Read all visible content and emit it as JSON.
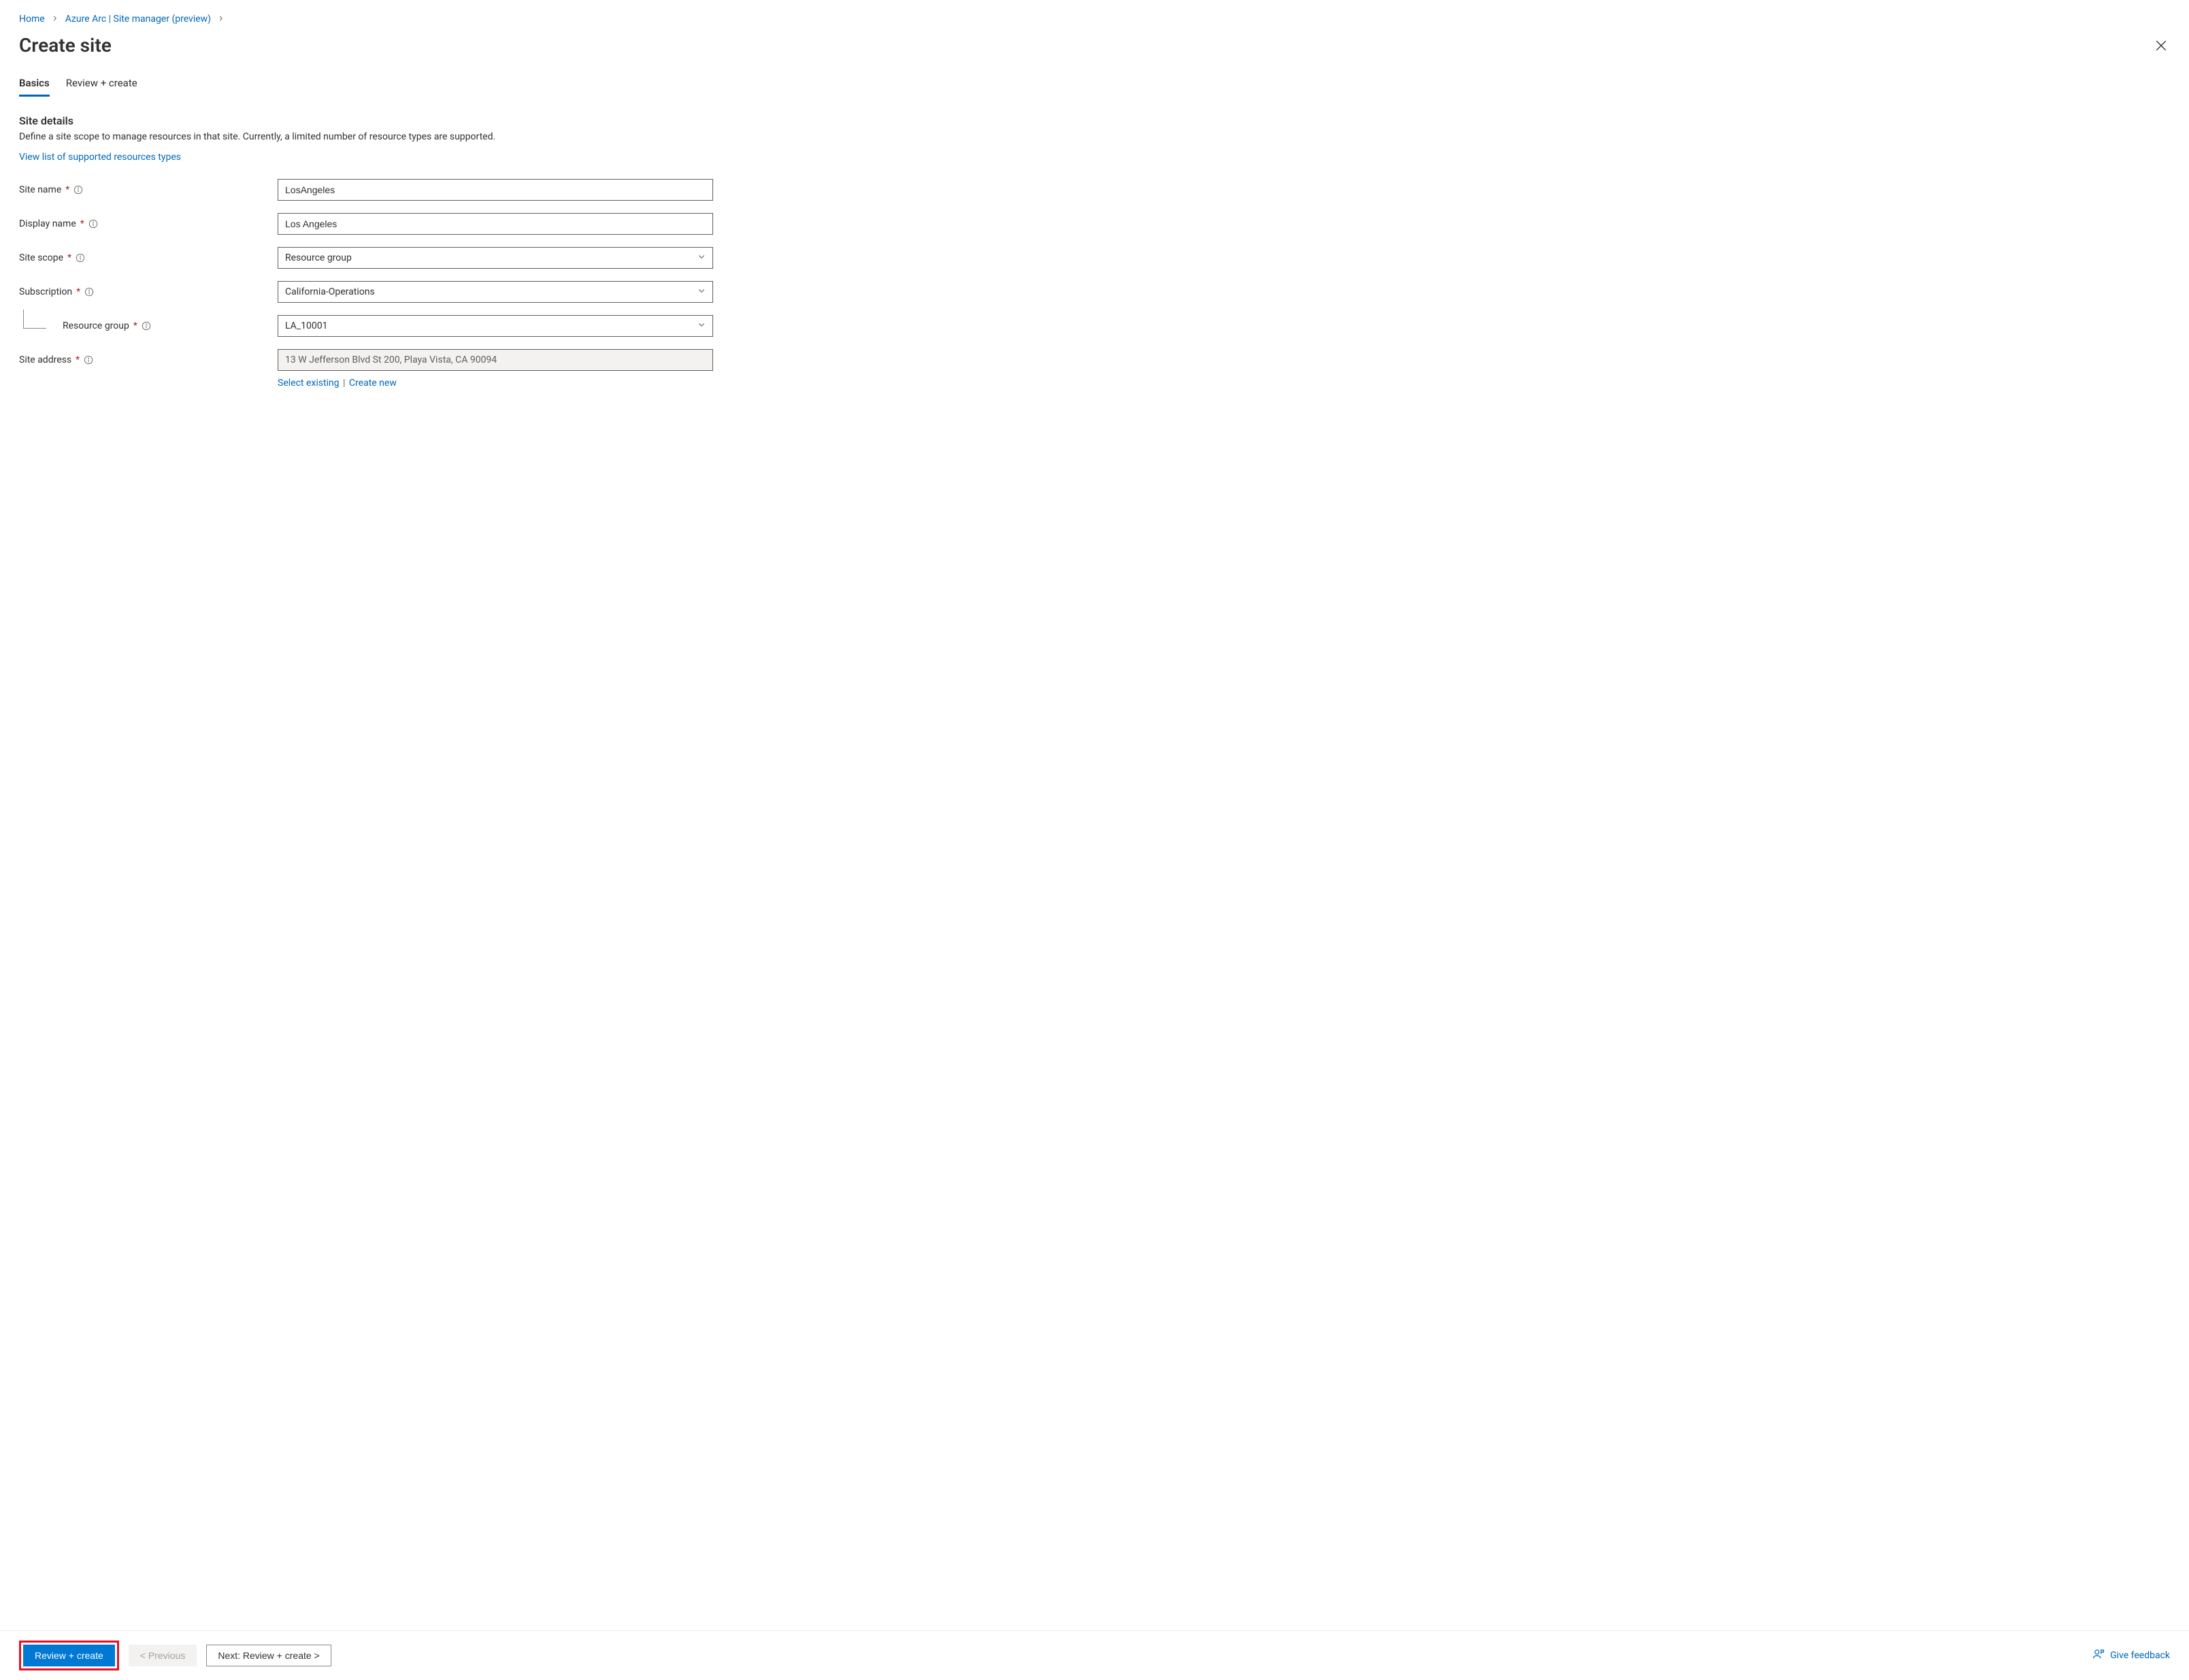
{
  "breadcrumb": {
    "items": [
      {
        "label": "Home"
      },
      {
        "label": "Azure Arc | Site manager (preview)"
      }
    ]
  },
  "header": {
    "title": "Create site"
  },
  "tabs": [
    {
      "label": "Basics",
      "active": true
    },
    {
      "label": "Review + create",
      "active": false
    }
  ],
  "section": {
    "title": "Site details",
    "description": "Define a site scope to manage resources in that site. Currently, a limited number of resource types are supported.",
    "supported_link": "View list of supported resources types"
  },
  "form": {
    "site_name": {
      "label": "Site name",
      "value": "LosAngeles"
    },
    "display_name": {
      "label": "Display name",
      "value": "Los Angeles"
    },
    "site_scope": {
      "label": "Site scope",
      "value": "Resource group"
    },
    "subscription": {
      "label": "Subscription",
      "value": "California-Operations"
    },
    "resource_group": {
      "label": "Resource group",
      "value": "LA_10001"
    },
    "site_address": {
      "label": "Site address",
      "value": "13 W Jefferson Blvd St 200, Playa Vista, CA 90094",
      "select_existing": "Select existing",
      "create_new": "Create new"
    }
  },
  "footer": {
    "review_create": "Review + create",
    "previous": "< Previous",
    "next": "Next: Review + create >",
    "feedback": "Give feedback"
  }
}
